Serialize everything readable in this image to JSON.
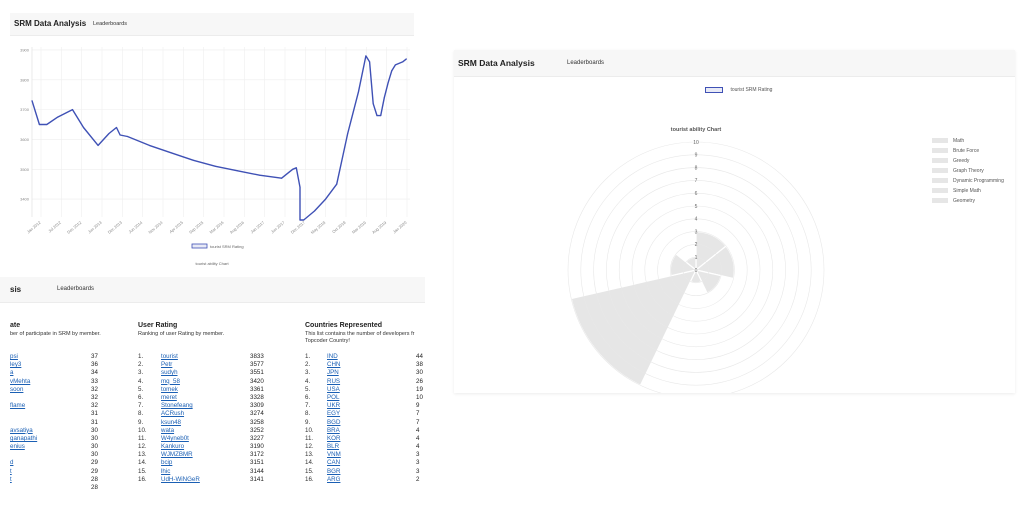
{
  "top_left": {
    "brand": "SRM Data Analysis",
    "nav": [
      "Leaderboards"
    ],
    "chart_caption": "tourist ability Chart",
    "chart_data": {
      "type": "line",
      "series": [
        {
          "name": "tourist SRM Rating",
          "x": [
            "2011-10",
            "2011-12",
            "2012-02",
            "2012-05",
            "2012-09",
            "2012-12",
            "2013-04",
            "2013-07",
            "2013-09",
            "2013-10",
            "2013-12",
            "2014-06",
            "2014-12",
            "2015-06",
            "2015-12",
            "2016-06",
            "2016-12",
            "2017-06",
            "2017-08",
            "2017-09",
            "2017-10",
            "2017-11",
            "2017-11",
            "2017-12",
            "2018-03",
            "2018-06",
            "2018-09",
            "2018-12",
            "2019-03",
            "2019-05",
            "2019-06",
            "2019-07",
            "2019-08",
            "2019-09",
            "2019-10",
            "2019-11",
            "2019-12",
            "2020-01",
            "2020-03",
            "2020-04"
          ],
          "y": [
            3730,
            3650,
            3650,
            3675,
            3700,
            3640,
            3580,
            3620,
            3640,
            3615,
            3610,
            3580,
            3555,
            3530,
            3510,
            3495,
            3480,
            3470,
            3490,
            3500,
            3505,
            3440,
            3330,
            3330,
            3360,
            3400,
            3450,
            3620,
            3760,
            3880,
            3860,
            3720,
            3680,
            3680,
            3740,
            3790,
            3830,
            3850,
            3860,
            3870
          ]
        }
      ],
      "x_tick_labels": [
        "Jan 2012",
        "Jul 2012",
        "Dec 2012",
        "Jun 2013",
        "Dec 2013",
        "Jun 2014",
        "Nov 2014",
        "Apr 2015",
        "Sep 2015",
        "Mar 2016",
        "Aug 2016",
        "Jan 2017",
        "Jun 2017",
        "Dec 2017",
        "May 2018",
        "Oct 2018",
        "Mar 2019",
        "Aug 2019",
        "Jan 2020"
      ],
      "y_ticks": [
        3900,
        3800,
        3700,
        3600,
        3500,
        3400
      ],
      "ylim": [
        3340,
        3910
      ],
      "grid": true,
      "legend": "bottom",
      "line_color": "#3f51b5"
    }
  },
  "bottom_left": {
    "brand": "sis",
    "nav": [
      "Leaderboards"
    ],
    "participation": {
      "title": "ate",
      "description": "ber of participate in SRM by member.",
      "rows": [
        {
          "name": "psi",
          "value": "37"
        },
        {
          "name": "ley3",
          "value": "36"
        },
        {
          "name": "a",
          "value": "34"
        },
        {
          "name": "vMehta",
          "value": "33"
        },
        {
          "name": "soon",
          "value": "32"
        },
        {
          "name": "",
          "value": "32"
        },
        {
          "name": "flame",
          "value": "32"
        },
        {
          "name": "",
          "value": "31"
        },
        {
          "name": "",
          "value": "31"
        },
        {
          "name": "avsatiya",
          "value": "30"
        },
        {
          "name": "ganapathi",
          "value": "30"
        },
        {
          "name": "enius",
          "value": "30"
        },
        {
          "name": "",
          "value": "30"
        },
        {
          "name": "d",
          "value": "29"
        },
        {
          "name": "t",
          "value": "29"
        },
        {
          "name": "t",
          "value": "28"
        },
        {
          "name": "",
          "value": "28"
        }
      ]
    },
    "user_rating": {
      "title": "User Rating",
      "description": "Ranking of user Rating by member.",
      "rows": [
        {
          "rank": "1.",
          "name": "tourist",
          "value": "3833"
        },
        {
          "rank": "2.",
          "name": "Petr",
          "value": "3577"
        },
        {
          "rank": "3.",
          "name": "sudyh",
          "value": "3551"
        },
        {
          "rank": "4.",
          "name": "mq_58",
          "value": "3420"
        },
        {
          "rank": "5.",
          "name": "tomek",
          "value": "3361"
        },
        {
          "rank": "6.",
          "name": "meret",
          "value": "3328"
        },
        {
          "rank": "7.",
          "name": "Stonefeang",
          "value": "3309"
        },
        {
          "rank": "8.",
          "name": "ACRush",
          "value": "3274"
        },
        {
          "rank": "9.",
          "name": "ksun48",
          "value": "3258"
        },
        {
          "rank": "10.",
          "name": "wata",
          "value": "3252"
        },
        {
          "rank": "11.",
          "name": "W4yneb0t",
          "value": "3227"
        },
        {
          "rank": "12.",
          "name": "Kankuro",
          "value": "3190"
        },
        {
          "rank": "13.",
          "name": "WJMZBMR",
          "value": "3172"
        },
        {
          "rank": "14.",
          "name": "bcip",
          "value": "3151"
        },
        {
          "rank": "15.",
          "name": "lhic",
          "value": "3144"
        },
        {
          "rank": "16.",
          "name": "UdH-WiNGeR",
          "value": "3141"
        }
      ]
    },
    "countries": {
      "title": "Countries Represented",
      "description_lines": [
        "This list contains the number of developers fr",
        "Topcoder Country!"
      ],
      "rows": [
        {
          "rank": "1.",
          "name": "IND",
          "value": "44"
        },
        {
          "rank": "2.",
          "name": "CHN",
          "value": "38"
        },
        {
          "rank": "3.",
          "name": "JPN",
          "value": "30"
        },
        {
          "rank": "4.",
          "name": "RUS",
          "value": "26"
        },
        {
          "rank": "5.",
          "name": "USA",
          "value": "19"
        },
        {
          "rank": "6.",
          "name": "POL",
          "value": "10"
        },
        {
          "rank": "7.",
          "name": "UKR",
          "value": "9"
        },
        {
          "rank": "8.",
          "name": "EGY",
          "value": "7"
        },
        {
          "rank": "9.",
          "name": "BGD",
          "value": "7"
        },
        {
          "rank": "10.",
          "name": "BRA",
          "value": "4"
        },
        {
          "rank": "11.",
          "name": "KOR",
          "value": "4"
        },
        {
          "rank": "12.",
          "name": "BLR",
          "value": "4"
        },
        {
          "rank": "13.",
          "name": "VNM",
          "value": "3"
        },
        {
          "rank": "14.",
          "name": "CAN",
          "value": "3"
        },
        {
          "rank": "15.",
          "name": "BGR",
          "value": "3"
        },
        {
          "rank": "16.",
          "name": "ARG",
          "value": "2"
        }
      ]
    }
  },
  "right": {
    "brand": "SRM Data Analysis",
    "nav": [
      "Leaderboards"
    ],
    "legend_top": "tourist SRM Rating",
    "chart_data": {
      "type": "radar",
      "title": "tourist ability Chart",
      "categories": [
        "Math",
        "Brute Force",
        "Greedy",
        "Graph Theory",
        "Dynamic Programming",
        "Simple Math",
        "Geometry"
      ],
      "values": [
        3,
        3,
        2,
        1,
        10,
        2,
        1
      ],
      "r_ticks": [
        0,
        1,
        2,
        3,
        4,
        5,
        6,
        7,
        8,
        9,
        10
      ],
      "rlim": [
        0,
        10
      ],
      "legend": "right",
      "fill_color": "#e6e6e6"
    }
  }
}
